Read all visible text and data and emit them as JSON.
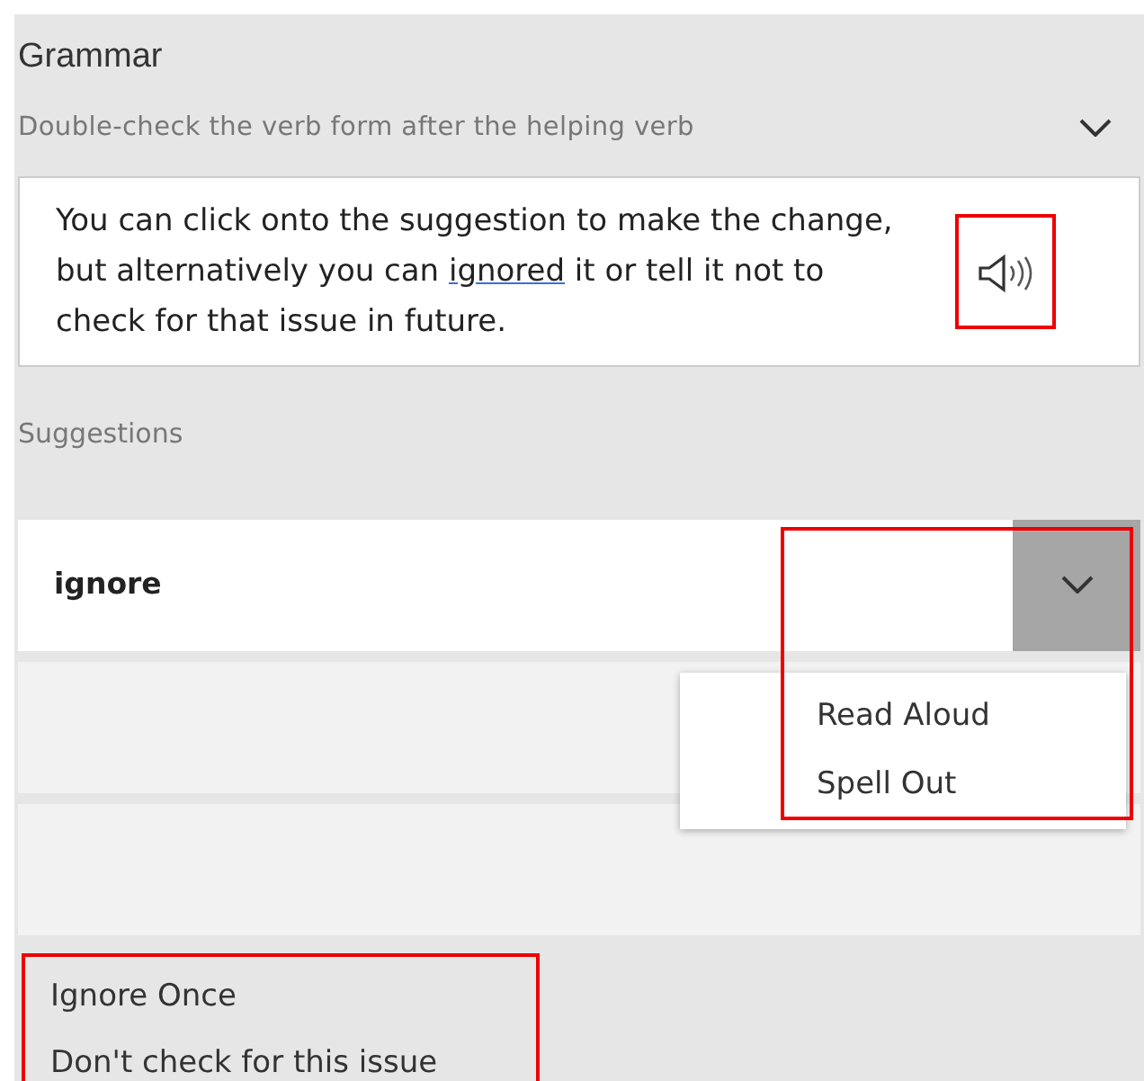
{
  "title": "Grammar",
  "issue": {
    "text": "Double-check the verb form after the helping verb",
    "expanded": true
  },
  "explanation": {
    "before": "You can click onto the suggestion to make the change, but alternatively you can ",
    "link": "ignored",
    "after": " it or tell it not to check for that issue in future.",
    "speaker_highlighted": true
  },
  "suggestions_label": "Suggestions",
  "suggestions": [
    {
      "kind": "word",
      "text": "ignore"
    },
    {
      "kind": "empty"
    },
    {
      "kind": "empty"
    }
  ],
  "menu": {
    "highlighted": true,
    "items": [
      {
        "label": "Read Aloud"
      },
      {
        "label": "Spell Out"
      }
    ]
  },
  "actions": {
    "highlighted": true,
    "items": [
      {
        "label": "Ignore Once"
      },
      {
        "label": "Don't check for this issue"
      }
    ]
  }
}
